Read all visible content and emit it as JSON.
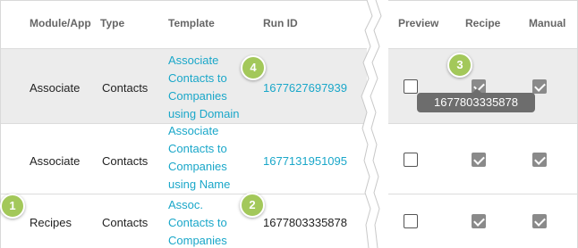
{
  "columns": {
    "module": "Module/App",
    "type": "Type",
    "template": "Template",
    "run_id": "Run ID",
    "preview": "Preview",
    "recipe": "Recipe",
    "manual": "Manual"
  },
  "rows": [
    {
      "module": "Associate",
      "type": "Contacts",
      "template_lines": [
        "Associate",
        "Contacts to",
        "Companies",
        "using Domain"
      ],
      "run_id": "1677627697939",
      "run_id_is_link": true,
      "preview": false,
      "recipe": true,
      "manual": true
    },
    {
      "module": "Associate",
      "type": "Contacts",
      "template_lines": [
        "Associate",
        "Contacts to",
        "Companies",
        "using Name"
      ],
      "run_id": "1677131951095",
      "run_id_is_link": true,
      "preview": false,
      "recipe": true,
      "manual": true
    },
    {
      "module": "Recipes",
      "type": "Contacts",
      "template_lines": [
        "Assoc.",
        "Contacts to",
        "Companies"
      ],
      "run_id": "1677803335878",
      "run_id_is_link": false,
      "preview": false,
      "recipe": true,
      "manual": true
    }
  ],
  "tooltip": {
    "text": "1677803335878"
  },
  "markers": [
    "1",
    "2",
    "3",
    "4"
  ],
  "colors": {
    "link": "#1aa7c9",
    "marker": "#a3c85a",
    "highlight_row": "#ececec",
    "tooltip": "#6d6d6d"
  }
}
